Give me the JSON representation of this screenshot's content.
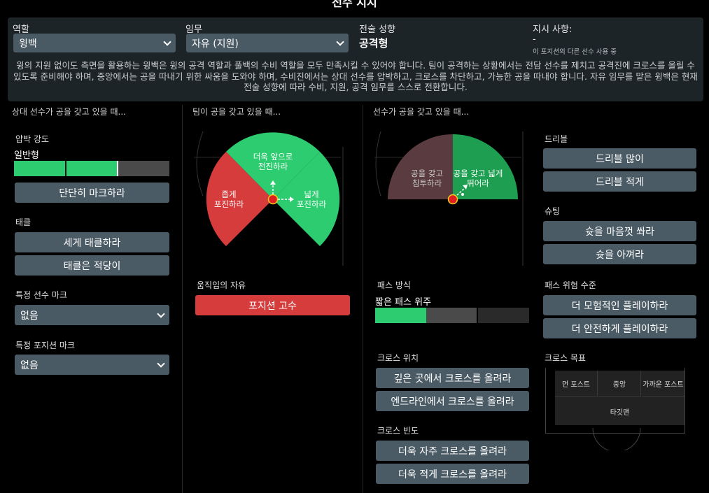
{
  "page_title": "선수 지시",
  "top": {
    "role_label": "역할",
    "role_value": "윙백",
    "duty_label": "임무",
    "duty_value": "자유 (지원)",
    "mentality_label": "전술 성향",
    "mentality_value": "공격형",
    "instructions_label": "지시 사항:",
    "instructions_value": "-",
    "instructions_note": "이 포지션의 다른 선수 사용 중",
    "description": "윙의 지원 없이도 측면을 활용하는 윙백은 윙의 공격 역할과 풀백의 수비 역할을 모두 만족시킬 수 있어야 합니다. 팀이 공격하는 상황에서는 전담 선수를 제치고 공격진에 크로스를 올릴 수 있도록 준비해야 하며, 중앙에서는 공을 따내기 위한 싸움을 도와야 하며, 수비진에서는 상대 선수를 압박하고, 크로스를 차단하고, 가능한 공을 따내야 합니다. 자유 임무를 맡은 윙백은 현재 전술 성향에 따라 수비, 지원, 공격 임무를 스스로 전환합니다."
  },
  "col1": {
    "caption": "상대 선수가 공을 갖고 있을 때...",
    "pressing_label": "압박 강도",
    "pressing_value": "일반형",
    "pressing_level": 0.67,
    "pressing_button": "단단히 마크하라",
    "tackle_label": "태클",
    "tackle_buttons": [
      "세게 태클하라",
      "태클은 적당이"
    ],
    "mark_player_label": "특정 선수 마크",
    "mark_player_value": "없음",
    "mark_position_label": "특정 포지션 마크",
    "mark_position_value": "없음"
  },
  "col2": {
    "caption": "팀이 공을 갖고 있을 때...",
    "dial_up": "더욱 앞으로\n전진하라",
    "dial_left": "좁게\n포진하라",
    "dial_right": "넓게\n포진하라",
    "freedom_label": "움직임의 자유",
    "freedom_button": "포지션 고수"
  },
  "col3": {
    "caption": "선수가 공을 갖고 있을 때...",
    "dial_left": "공을 갖고\n침투하라",
    "dial_right": "공을 갖고 넓게\n뛰어라",
    "dribble_label": "드리블",
    "dribble_buttons": [
      "드리블 많이",
      "드리블 적게"
    ],
    "shooting_label": "슈팅",
    "shooting_buttons": [
      "슛을 마음껏 쏴라",
      "슛을 아껴라"
    ],
    "passing_label": "패스 방식",
    "passing_value": "짧은 패스 위주",
    "passing_level": 0.33,
    "risk_label": "패스 위험 수준",
    "risk_buttons": [
      "더 모험적인 플레이하라",
      "더 안전하게 플레이하라"
    ],
    "cross_pos_label": "크로스 위치",
    "cross_pos_buttons": [
      "깊은 곳에서 크로스를 올려라",
      "엔드라인에서 크로스를 올려라"
    ],
    "cross_freq_label": "크로스 빈도",
    "cross_freq_buttons": [
      "더욱 자주 크로스를 올려라",
      "더욱 적게 크로스를 올려라"
    ],
    "cross_target_label": "크로스 목표",
    "cross_targets": [
      "먼 포스트",
      "중앙",
      "가까운 포스트",
      "타깃맨"
    ]
  },
  "colors": {
    "green": "#2ecc71",
    "dark_green": "#1e9e50",
    "red": "#d63c3c",
    "dark_red": "#5a3c40",
    "button": "#4b5b66"
  }
}
